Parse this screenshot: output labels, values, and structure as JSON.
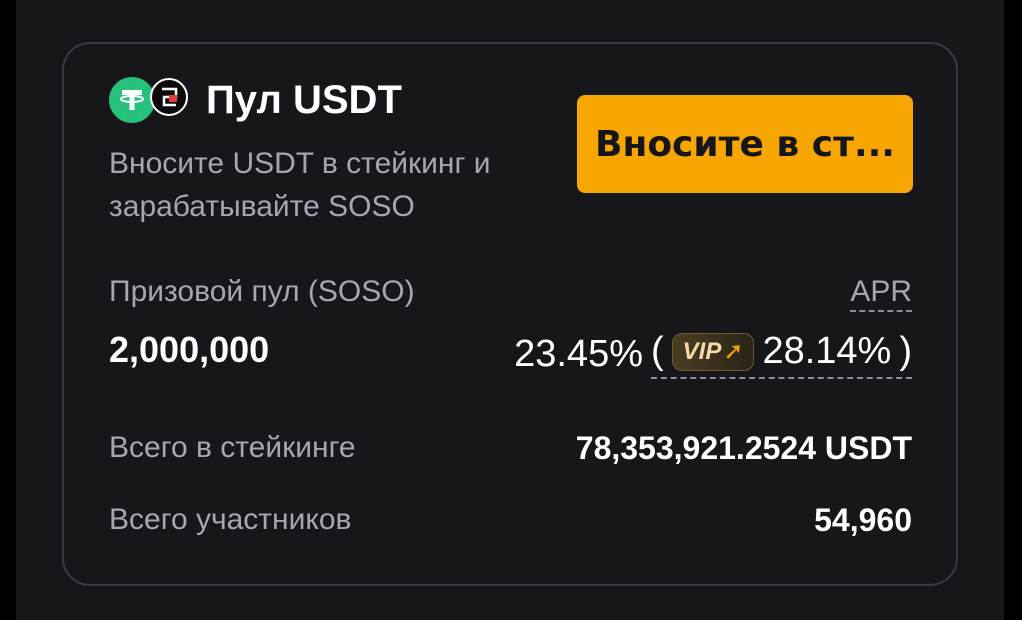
{
  "pool": {
    "title": "Пул USDT",
    "description": "Вносите USDT в стейкинг и зарабатывайте SOSO",
    "stake_button": "Вносите в ст...",
    "prize_label": "Призовой пул (SOSO)",
    "prize_value": "2,000,000",
    "apr_label": "APR",
    "apr_value": "23.45%",
    "paren_open": "(",
    "vip_label": "VIP",
    "vip_apr_value": "28.14%",
    "paren_close": ")",
    "total_staked_label": "Всего в стейкинге",
    "total_staked_value": "78,353,921.2524 USDT",
    "participants_label": "Всего участников",
    "participants_value": "54,960"
  },
  "colors": {
    "background": "#000000",
    "card": "#17171b",
    "accent": "#f7a600",
    "usdt": "#26c17c"
  },
  "icons": [
    "usdt-coin-icon",
    "soso-coin-icon",
    "vip-arrow-icon"
  ]
}
